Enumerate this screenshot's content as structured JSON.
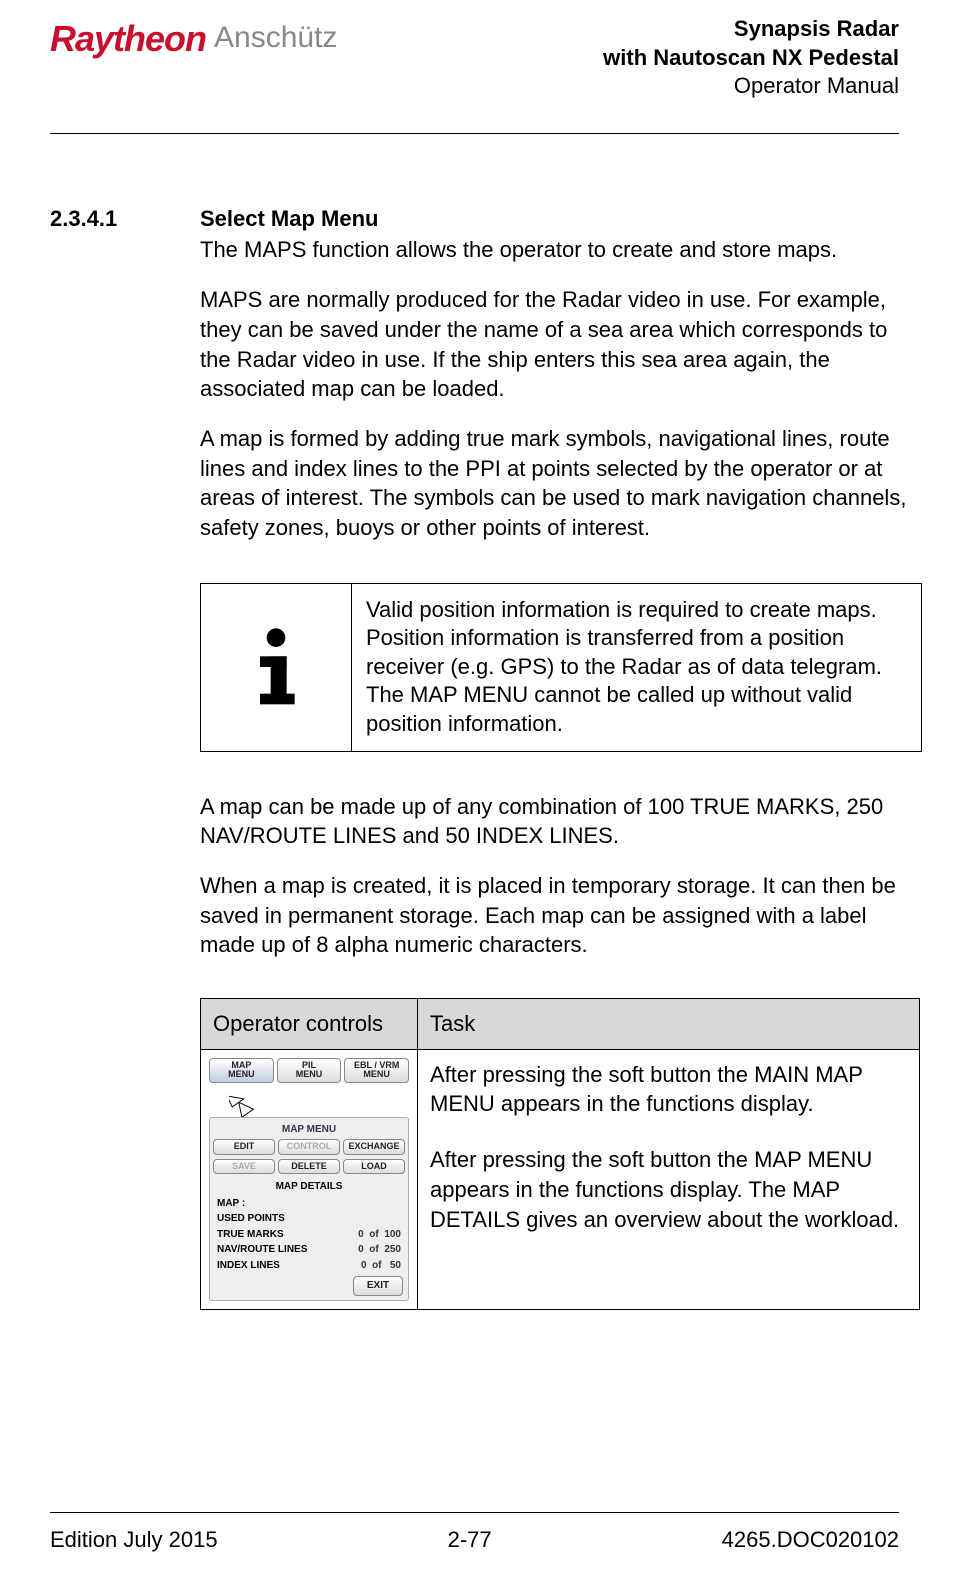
{
  "header": {
    "logo_brand_1": "Raytheon",
    "logo_brand_2": "Anschütz",
    "title_line_1": "Synapsis Radar",
    "title_line_2": "with Nautoscan NX Pedestal",
    "title_line_3": "Operator Manual"
  },
  "section": {
    "number": "2.3.4.1",
    "title": "Select Map Menu",
    "para_1": "The MAPS function allows the operator to create and store maps.",
    "para_2": "MAPS are normally produced for the Radar video in use. For example, they can be saved under the name of a sea area which corresponds to the Radar video in use. If the ship enters this sea area again, the associated map can be loaded.",
    "para_3": "A map is formed by adding true mark symbols, navigational lines, route lines and index lines to the PPI at points selected by the operator or at areas of interest. The symbols can be used to mark navigation channels, safety zones, buoys or other points of interest.",
    "info_box": "Valid position information is required to create maps. Position information is transferred from a position receiver (e.g. GPS) to the Radar as of data telegram.\nThe MAP MENU cannot be called up without valid position information.",
    "para_4": "A map can be made up of any combination of 100 TRUE MARKS, 250 NAV/ROUTE LINES and 50 INDEX LINES.",
    "para_5": "When a map is created, it is placed in temporary storage. It can then be saved in permanent storage. Each map can be assigned with a label made up of 8 alpha numeric characters."
  },
  "op_table": {
    "head_controls": "Operator controls",
    "head_task": "Task",
    "task_text_1": "After pressing the soft button the MAIN MAP MENU appears in the functions display.",
    "task_text_2": "After pressing the soft button the MAP MENU appears in the functions display. The MAP DETAILS gives an overview about the workload.",
    "controls": {
      "top_buttons": [
        {
          "l1": "MAP",
          "l2": "MENU"
        },
        {
          "l1": "PIL",
          "l2": "MENU"
        },
        {
          "l1": "EBL / VRM",
          "l2": "MENU"
        }
      ],
      "panel_title": "MAP MENU",
      "row1": [
        "EDIT",
        "CONTROL",
        "EXCHANGE"
      ],
      "row2": [
        "SAVE",
        "DELETE",
        "LOAD"
      ],
      "details_title": "MAP DETAILS",
      "map_label": "MAP :",
      "used_points": "USED POINTS",
      "rows": [
        {
          "label": "TRUE MARKS",
          "used": "0",
          "of": "of",
          "total": "100"
        },
        {
          "label": "NAV/ROUTE LINES",
          "used": "0",
          "of": "of",
          "total": "250"
        },
        {
          "label": "INDEX LINES",
          "used": "0",
          "of": "of",
          "total": "50"
        }
      ],
      "exit": "EXIT"
    }
  },
  "footer": {
    "left": "Edition July 2015",
    "center": "2-77",
    "right": "4265.DOC020102"
  }
}
